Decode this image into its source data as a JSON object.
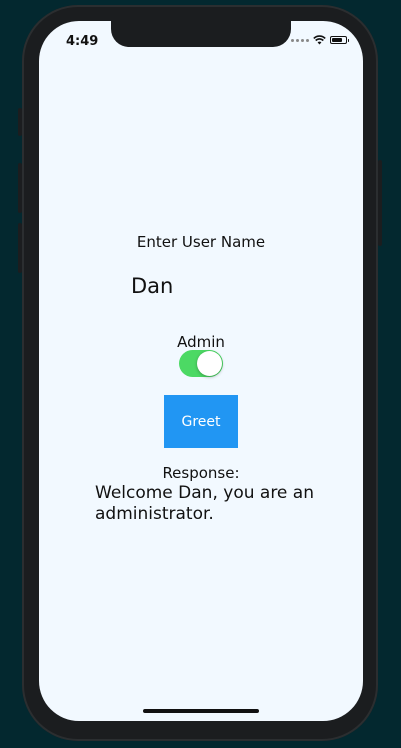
{
  "status_bar": {
    "time": "4:49",
    "signal_icon": "signal-dots-icon",
    "wifi_icon": "wifi-icon",
    "battery_icon": "battery-icon"
  },
  "form": {
    "user_name_label": "Enter User Name",
    "user_name_value": "Dan",
    "admin_label": "Admin",
    "admin_on": true,
    "greet_label": "Greet",
    "response_label": "Response:",
    "response_text": "Welcome Dan, you are an administrator."
  },
  "colors": {
    "switch_on": "#4cd964",
    "button_bg": "#2196f3",
    "screen_bg": "#f2f9ff"
  }
}
